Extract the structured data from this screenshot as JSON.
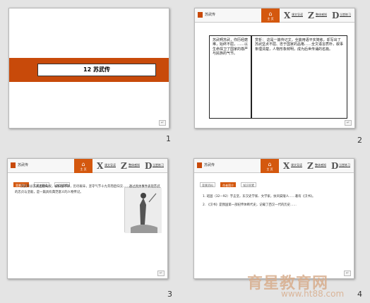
{
  "slides": [
    {
      "number": "1",
      "title": "12 苏武传"
    },
    {
      "number": "2",
      "left_text": "苏武啊苏武，你历经磨难，始终不屈，……以生命捍卫了国家的尊严与民族的气节。",
      "right_label": "赏析：",
      "right_text": "这是一篇传记文，全篇用语平实简练，却写出了苏武坚贞不屈、忠于国家的品格……全文语言质朴，叙事条理清楚，人物形象鲜明，成为后世传诵的名篇。"
    },
    {
      "number": "3",
      "text": "汉武帝派苏武出使匈奴，被扣留不降，历尽艰辛，坚守气节十九年而后归汉……通过具体事件表现苏武的忠贞与坚毅，是一篇具有典范意义的人物传记。"
    },
    {
      "number": "4",
      "paragraphs": [
        "1. 班固（32—92）字孟坚，东汉史学家、文学家，扶风安陵人……著有《汉书》。",
        "2. 《汉书》是我国第一部纪传体断代史，记载了西汉一代的历史……"
      ]
    }
  ],
  "header": {
    "brand": "苏武传",
    "home_label": "主 页",
    "home_glyph": "⌂",
    "buttons": [
      {
        "letter": "X",
        "label": "课文导读"
      },
      {
        "letter": "Z",
        "label": "整体感知"
      },
      {
        "letter": "D",
        "label": "当堂练习"
      }
    ]
  },
  "tabs3": [
    "背景资料",
    "课文解读",
    "知识积累"
  ],
  "tabs4": [
    "背景资料",
    "作者简介",
    "知识积累"
  ],
  "corner_tag": "↵",
  "watermark": {
    "brand": "育星教育网",
    "url": "www.ht88.com"
  }
}
